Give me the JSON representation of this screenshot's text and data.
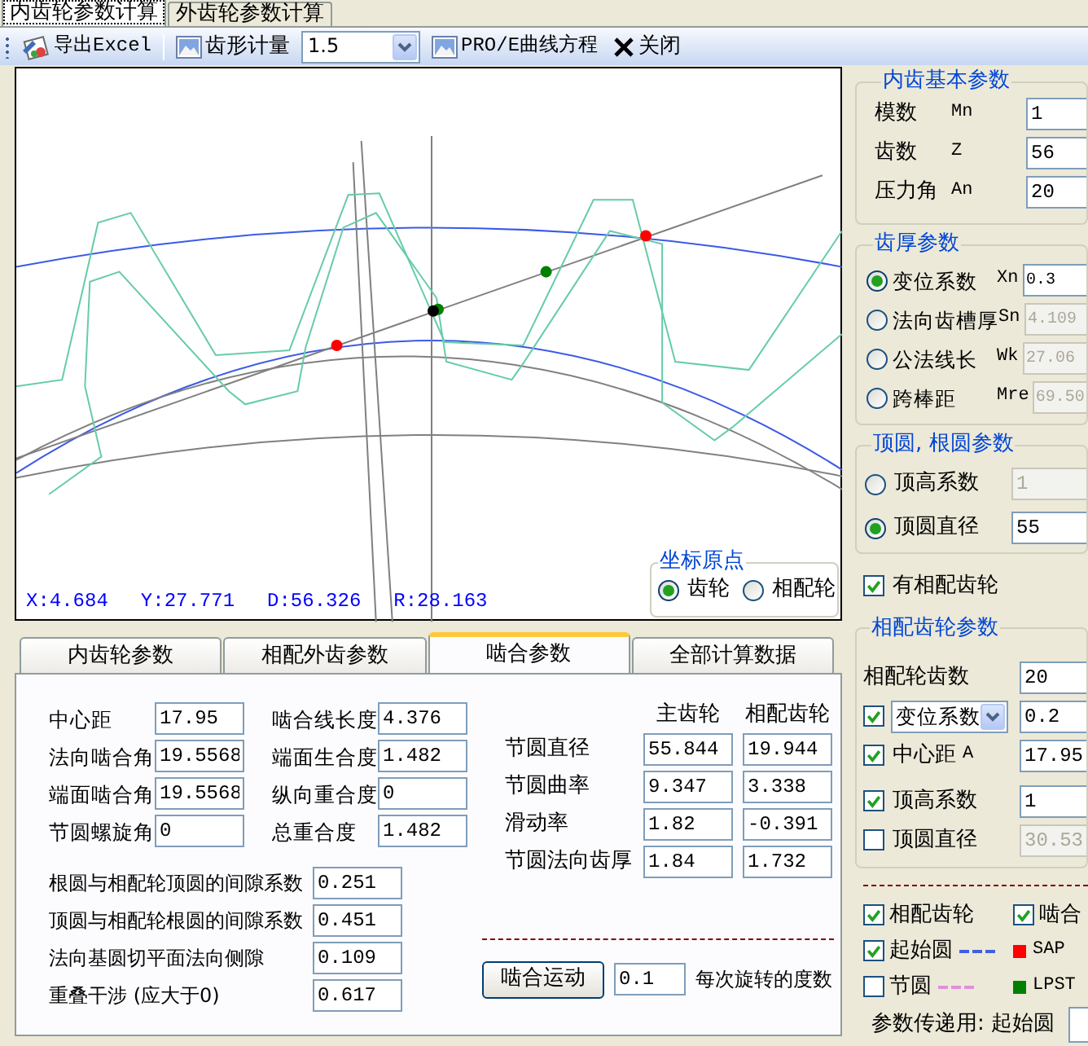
{
  "window_tabs": [
    {
      "label": "内齿轮参数计算",
      "selected": true
    },
    {
      "label": "外齿轮参数计算",
      "selected": false
    }
  ],
  "toolbar": {
    "items": [
      {
        "kind": "export",
        "label": "导出Excel"
      },
      {
        "kind": "image",
        "label": "齿形计量"
      },
      {
        "kind": "combo",
        "value": "1.5"
      },
      {
        "kind": "image",
        "label": "PRO/E曲线方程"
      },
      {
        "kind": "close",
        "label": "关闭"
      }
    ]
  },
  "canvas": {
    "readouts": [
      "X:4.684",
      "Y:27.771",
      "D:56.326",
      "R:28.163"
    ],
    "origin_group": {
      "title": "坐标原点",
      "options": [
        {
          "label": "齿轮",
          "selected": true
        },
        {
          "label": "相配轮",
          "selected": false
        }
      ]
    }
  },
  "bottom_tabs": [
    {
      "label": "内齿轮参数",
      "selected": false
    },
    {
      "label": "相配外齿参数",
      "selected": false
    },
    {
      "label": "啮合参数",
      "selected": true
    },
    {
      "label": "全部计算数据",
      "selected": false
    }
  ],
  "mesh": {
    "left_fields": [
      {
        "label": "中心距",
        "value": "17.95"
      },
      {
        "label": "法向啮合角",
        "value": "19.5568"
      },
      {
        "label": "端面啮合角",
        "value": "19.5568"
      },
      {
        "label": "节圆螺旋角",
        "value": "0"
      }
    ],
    "middle_fields": [
      {
        "label": "啮合线长度",
        "value": "4.376"
      },
      {
        "label": "端面生合度",
        "value": "1.482"
      },
      {
        "label": "纵向重合度",
        "value": "0"
      },
      {
        "label": "总重合度",
        "value": "1.482"
      }
    ],
    "clearance_fields": [
      {
        "label": "根圆与相配轮顶圆的间隙系数",
        "value": "0.251"
      },
      {
        "label": "顶圆与相配轮根圆的间隙系数",
        "value": "0.451"
      },
      {
        "label": "法向基圆切平面法向侧隙",
        "value": "0.109"
      },
      {
        "label": "重叠干涉 (应大于0)",
        "value": "0.617"
      }
    ],
    "gear_columns": [
      "主齿轮",
      "相配齿轮"
    ],
    "gear_rows": [
      {
        "label": "节圆直径",
        "values": [
          "55.844",
          "19.944"
        ]
      },
      {
        "label": "节圆曲率",
        "values": [
          "9.347",
          "3.338"
        ]
      },
      {
        "label": "滑动率",
        "values": [
          "1.82",
          "-0.391"
        ]
      },
      {
        "label": "节圆法向齿厚",
        "values": [
          "1.84",
          "1.732"
        ]
      }
    ],
    "motion_button": "啮合运动",
    "step": "0.1",
    "step_label": "每次旋转的度数"
  },
  "right_panel": {
    "basic": {
      "title": "内齿基本参数",
      "rows": [
        {
          "label": "模数",
          "symbol": "Mn",
          "value": "1"
        },
        {
          "label": "齿数",
          "symbol": "Z",
          "value": "56"
        },
        {
          "label": "压力角",
          "symbol": "An",
          "value": "20"
        }
      ]
    },
    "thickness": {
      "title": "齿厚参数",
      "rows": [
        {
          "label": "变位系数",
          "symbol": "Xn",
          "value": "0.3",
          "selected": true,
          "disabled": false
        },
        {
          "label": "法向齿槽厚",
          "symbol": "Sn",
          "value": "4.109",
          "selected": false,
          "disabled": true
        },
        {
          "label": "公法线长",
          "symbol": "Wk",
          "value": "27.06",
          "selected": false,
          "disabled": true
        },
        {
          "label": "跨棒距",
          "symbol": "Mre",
          "value": "69.50",
          "selected": false,
          "disabled": true
        }
      ]
    },
    "tip": {
      "title": "顶圆, 根圆参数",
      "rows": [
        {
          "label": "顶高系数",
          "value": "1",
          "selected": false,
          "disabled": true
        },
        {
          "label": "顶圆直径",
          "value": "55",
          "selected": true,
          "disabled": false
        }
      ]
    },
    "has_mate": {
      "label": "有相配齿轮",
      "checked": true
    },
    "mate": {
      "title": "相配齿轮参数",
      "rows": [
        {
          "kind": "plain",
          "label": "相配轮齿数",
          "value": "20",
          "disabled": false
        },
        {
          "kind": "select",
          "checked": true,
          "label": "变位系数",
          "value": "0.2",
          "disabled": false
        },
        {
          "kind": "check",
          "checked": true,
          "label": "中心距",
          "symbol": "A",
          "value": "17.95",
          "disabled": false
        },
        {
          "kind": "check",
          "checked": true,
          "label": "顶高系数",
          "value": "1",
          "disabled": false
        },
        {
          "kind": "check",
          "checked": false,
          "label": "顶圆直径",
          "value": "30.53",
          "disabled": true
        }
      ]
    },
    "display": {
      "items": [
        {
          "kind": "check",
          "label": "相配齿轮",
          "checked": true
        },
        {
          "kind": "check",
          "label": "啮合",
          "checked": true
        },
        {
          "kind": "check",
          "label": "起始圆",
          "checked": true,
          "color": "#4060e0"
        },
        {
          "kind": "legend",
          "label": "SAP",
          "color": "#ff0000"
        },
        {
          "kind": "check",
          "label": "节圆",
          "checked": false,
          "color": "#e090d8"
        },
        {
          "kind": "legend",
          "label": "LPST",
          "color": "#008000"
        }
      ],
      "pass_label": "参数传递用:  起始圆"
    }
  }
}
